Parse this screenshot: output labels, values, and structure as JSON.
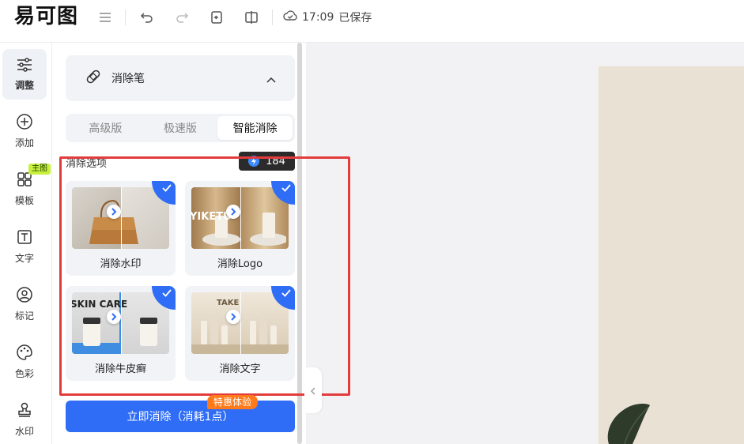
{
  "app": {
    "logo_text": "易可图",
    "save_time": "17:09",
    "save_status": "已保存"
  },
  "nav": {
    "items": [
      {
        "label": "调整",
        "icon": "sliders-icon",
        "active": true
      },
      {
        "label": "添加",
        "icon": "plus-circle-icon"
      },
      {
        "label": "模板",
        "icon": "grid-icon",
        "badge": "主图"
      },
      {
        "label": "文字",
        "icon": "text-icon"
      },
      {
        "label": "标记",
        "icon": "marker-icon"
      },
      {
        "label": "色彩",
        "icon": "palette-icon"
      },
      {
        "label": "水印",
        "icon": "stamp-icon"
      }
    ]
  },
  "tool": {
    "title": "消除笔",
    "tabs": [
      "高级版",
      "极速版",
      "智能消除"
    ],
    "active_tab": 2,
    "options_label": "消除选项",
    "credits": "184",
    "options": [
      {
        "label": "消除水印",
        "checked": true,
        "overlay_text": ""
      },
      {
        "label": "消除Logo",
        "checked": true,
        "overlay_text": "YIKETU"
      },
      {
        "label": "消除牛皮癣",
        "checked": true,
        "overlay_text": "SKIN CARE"
      },
      {
        "label": "消除文字",
        "checked": true,
        "overlay_text": "TAKE"
      }
    ],
    "promo_badge": "特惠体验",
    "cta_label": "立即消除（消耗1点）"
  },
  "colors": {
    "accent": "#2f6df6",
    "highlight": "#e33b3b",
    "promo": "#ff7a1a"
  }
}
